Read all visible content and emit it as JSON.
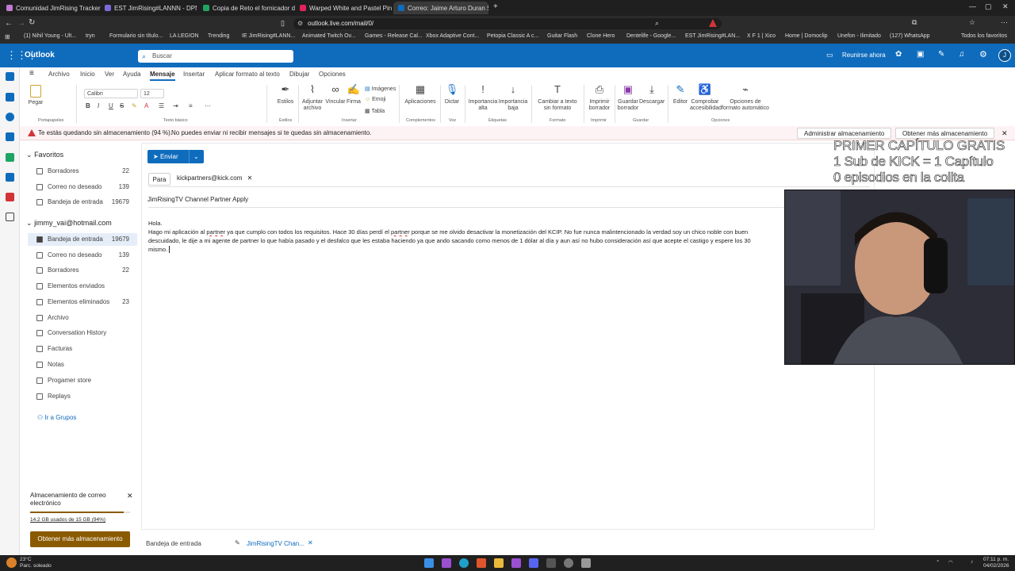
{
  "browser": {
    "tabs": [
      {
        "label": "Comunidad JimRising Tracker",
        "color": "#c27bd3"
      },
      {
        "label": "EST JimRising#LANNN - DPM.LOL",
        "color": "#7b6ad8"
      },
      {
        "label": "Copia de Reto el fornicador de la gra",
        "color": "#1fa463"
      },
      {
        "label": "Warped White and Pastel Pink Y2k fo",
        "color": "#e2245c"
      },
      {
        "label": "Correo: Jaime Arturo Duran Silv",
        "color": "#0f6cbd"
      }
    ],
    "new_tab": "+",
    "url": "outlook.live.com/mail/0/",
    "bookmarks": [
      "(1) Nihil Young - Ult...",
      "tryn",
      "Formulario sin título...",
      "LA LEGION",
      "Trending",
      "IE JimRising#LANN...",
      "Animated Twitch Ov...",
      "Games - Release Cal...",
      "Xbox Adaptive Cont...",
      "Petopia Classic A c...",
      "Guitar Flash",
      "Clone Hero",
      "Dentelife - Google...",
      "EST JimRising#LAN...",
      "X F 1 | Xico",
      "Home | Domoclip",
      "Unefon - Ilimitado",
      "(127) WhatsApp",
      "Todos los favoritos"
    ]
  },
  "outlook": {
    "app_name": "Outlook",
    "search_placeholder": "Buscar",
    "meet_now": "Reunirse ahora",
    "avatar_initial": "J"
  },
  "menu": [
    "Archivo",
    "Inicio",
    "Ver",
    "Ayuda",
    "Mensaje",
    "Insertar",
    "Aplicar formato al texto",
    "Dibujar",
    "Opciones"
  ],
  "menu_active": "Mensaje",
  "ribbon": {
    "paste": "Pegar",
    "font": "Calibri",
    "size": "12",
    "styles": "Estilos",
    "attach": "Adjuntar archivo",
    "link": "Vincular",
    "signature": "Firma",
    "images": "Imágenes",
    "emoji": "Emoji",
    "table": "Tabla",
    "apps": "Aplicaciones",
    "dictate": "Dictar",
    "high": "Importancia alta",
    "low": "Importancia baja",
    "plain": "Cambiar a texto sin formato",
    "print": "Imprimir borrador",
    "save": "Guardar borrador",
    "discard": "Descargar",
    "editor": "Editor",
    "access": "Comprobar accesibilidad",
    "autoformat": "Opciones de formato automático",
    "groups": [
      "Portapapeles",
      "Texto básico",
      "Estilos",
      "Insertar",
      "Complementos",
      "Voz",
      "Etiquetas",
      "Formato",
      "Imprimir",
      "Guardar",
      "Opciones"
    ]
  },
  "warning": {
    "text": "Te estás quedando sin almacenamiento (94 %).",
    "detail": "No puedes enviar ni recibir mensajes si te quedas sin almacenamiento.",
    "manage": "Administrar almacenamiento",
    "more": "Obtener más almacenamiento"
  },
  "folders": {
    "favorites_title": "Favoritos",
    "favorites": [
      {
        "label": "Borradores",
        "count": "22"
      },
      {
        "label": "Correo no deseado",
        "count": "139"
      },
      {
        "label": "Bandeja de entrada",
        "count": "19679"
      }
    ],
    "account": "jimmy_vai@hotmail.com",
    "items": [
      {
        "label": "Bandeja de entrada",
        "count": "19679"
      },
      {
        "label": "Correo no deseado",
        "count": "139"
      },
      {
        "label": "Borradores",
        "count": "22"
      },
      {
        "label": "Elementos enviados",
        "count": ""
      },
      {
        "label": "Elementos eliminados",
        "count": "23"
      },
      {
        "label": "Archivo",
        "count": ""
      },
      {
        "label": "Conversation History",
        "count": ""
      },
      {
        "label": "Facturas",
        "count": ""
      },
      {
        "label": "Notas",
        "count": ""
      },
      {
        "label": "Progamer store",
        "count": ""
      },
      {
        "label": "Replays",
        "count": ""
      }
    ],
    "groups_link": "Ir a Grupos",
    "storage_title": "Almacenamiento de correo electrónico",
    "storage_used": "14.2 GB usados de 15 GB (94%)",
    "storage_fraction": 0.94,
    "get_more": "Obtener más almacenamiento"
  },
  "compose": {
    "send": "Enviar",
    "to_label": "Para",
    "recipient": "kickpartners@kick.com",
    "subject": "JimRisingTV Channel Partner Apply",
    "greeting": "Hola.",
    "line1_a": "Hago mi aplicación al ",
    "line1_b": "partner",
    "line1_c": " ya que cumplo con todos los requisitos. Hace 30 días perdí el ",
    "line1_d": "partner",
    "line1_e": " porque se me olvido desactivar la monetización del KCIP. No fue nunca malintencionado la verdad soy un chico noble con buen",
    "line2": "descuidado, le dije a mi agente de partner lo que había pasado y el desfalco que les estaba haciendo ya que ando sacando como menos de 1 dólar al día y aun así no hubo consideración así que acepte el castigo y espere los 30",
    "line3": "mismo."
  },
  "overlay": {
    "line1": "PRIMER CAPÍTULO GRATIS",
    "line2": "1 Sub de KICK = 1 Capítulo",
    "line3": "0 episodios en la colita"
  },
  "bottom": {
    "inbox": "Bandeja de entrada",
    "draft": "JimRisingTV Chan..."
  },
  "taskbar": {
    "temp": "23°C",
    "weather": "Parc. soleado",
    "time": "07:11 p. m.",
    "date": "04/02/2026"
  },
  "colors": {
    "brand": "#0f6cbd",
    "warning": "#d13438",
    "storage_button": "#8a5a00"
  }
}
